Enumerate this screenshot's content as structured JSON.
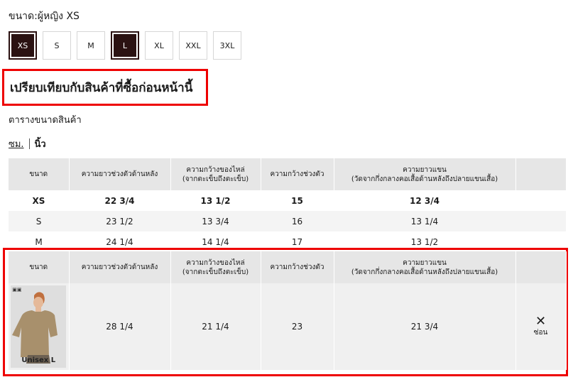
{
  "selected_size_label": "ขนาด:ผู้หญิง XS",
  "sizes": [
    "XS",
    "S",
    "M",
    "L",
    "XL",
    "XXL",
    "3XL"
  ],
  "compare_heading": "เปรียบเทียบกับสินค้าที่ซื้อก่อนหน้านี้",
  "chart_title": "ตารางขนาดสินค้า",
  "units": {
    "cm": "ซม.",
    "inch": "นิ้ว"
  },
  "columns": [
    "ขนาด",
    "ความยาวช่วงตัวด้านหลัง",
    "ความกว้างของไหล่\n(จากตะเข็บถึงตะเข็บ)",
    "ความกว้างช่วงตัว",
    "ความยาวแขน\n(วัดจากกึ่งกลางคอเสื้อด้านหลังถึงปลายแขนเสื้อ)"
  ],
  "rows": [
    [
      "XS",
      "22 3/4",
      "13 1/2",
      "15",
      "12 3/4"
    ],
    [
      "S",
      "23 1/2",
      "13 3/4",
      "16",
      "13 1/4"
    ],
    [
      "M",
      "24 1/4",
      "14 1/4",
      "17",
      "13 1/2"
    ]
  ],
  "compare_row": {
    "product_badge": "▣▣",
    "product_label": "Unisex L",
    "values": [
      "28 1/4",
      "21 1/4",
      "23",
      "21 3/4"
    ],
    "hide_label": "ซ่อน"
  }
}
